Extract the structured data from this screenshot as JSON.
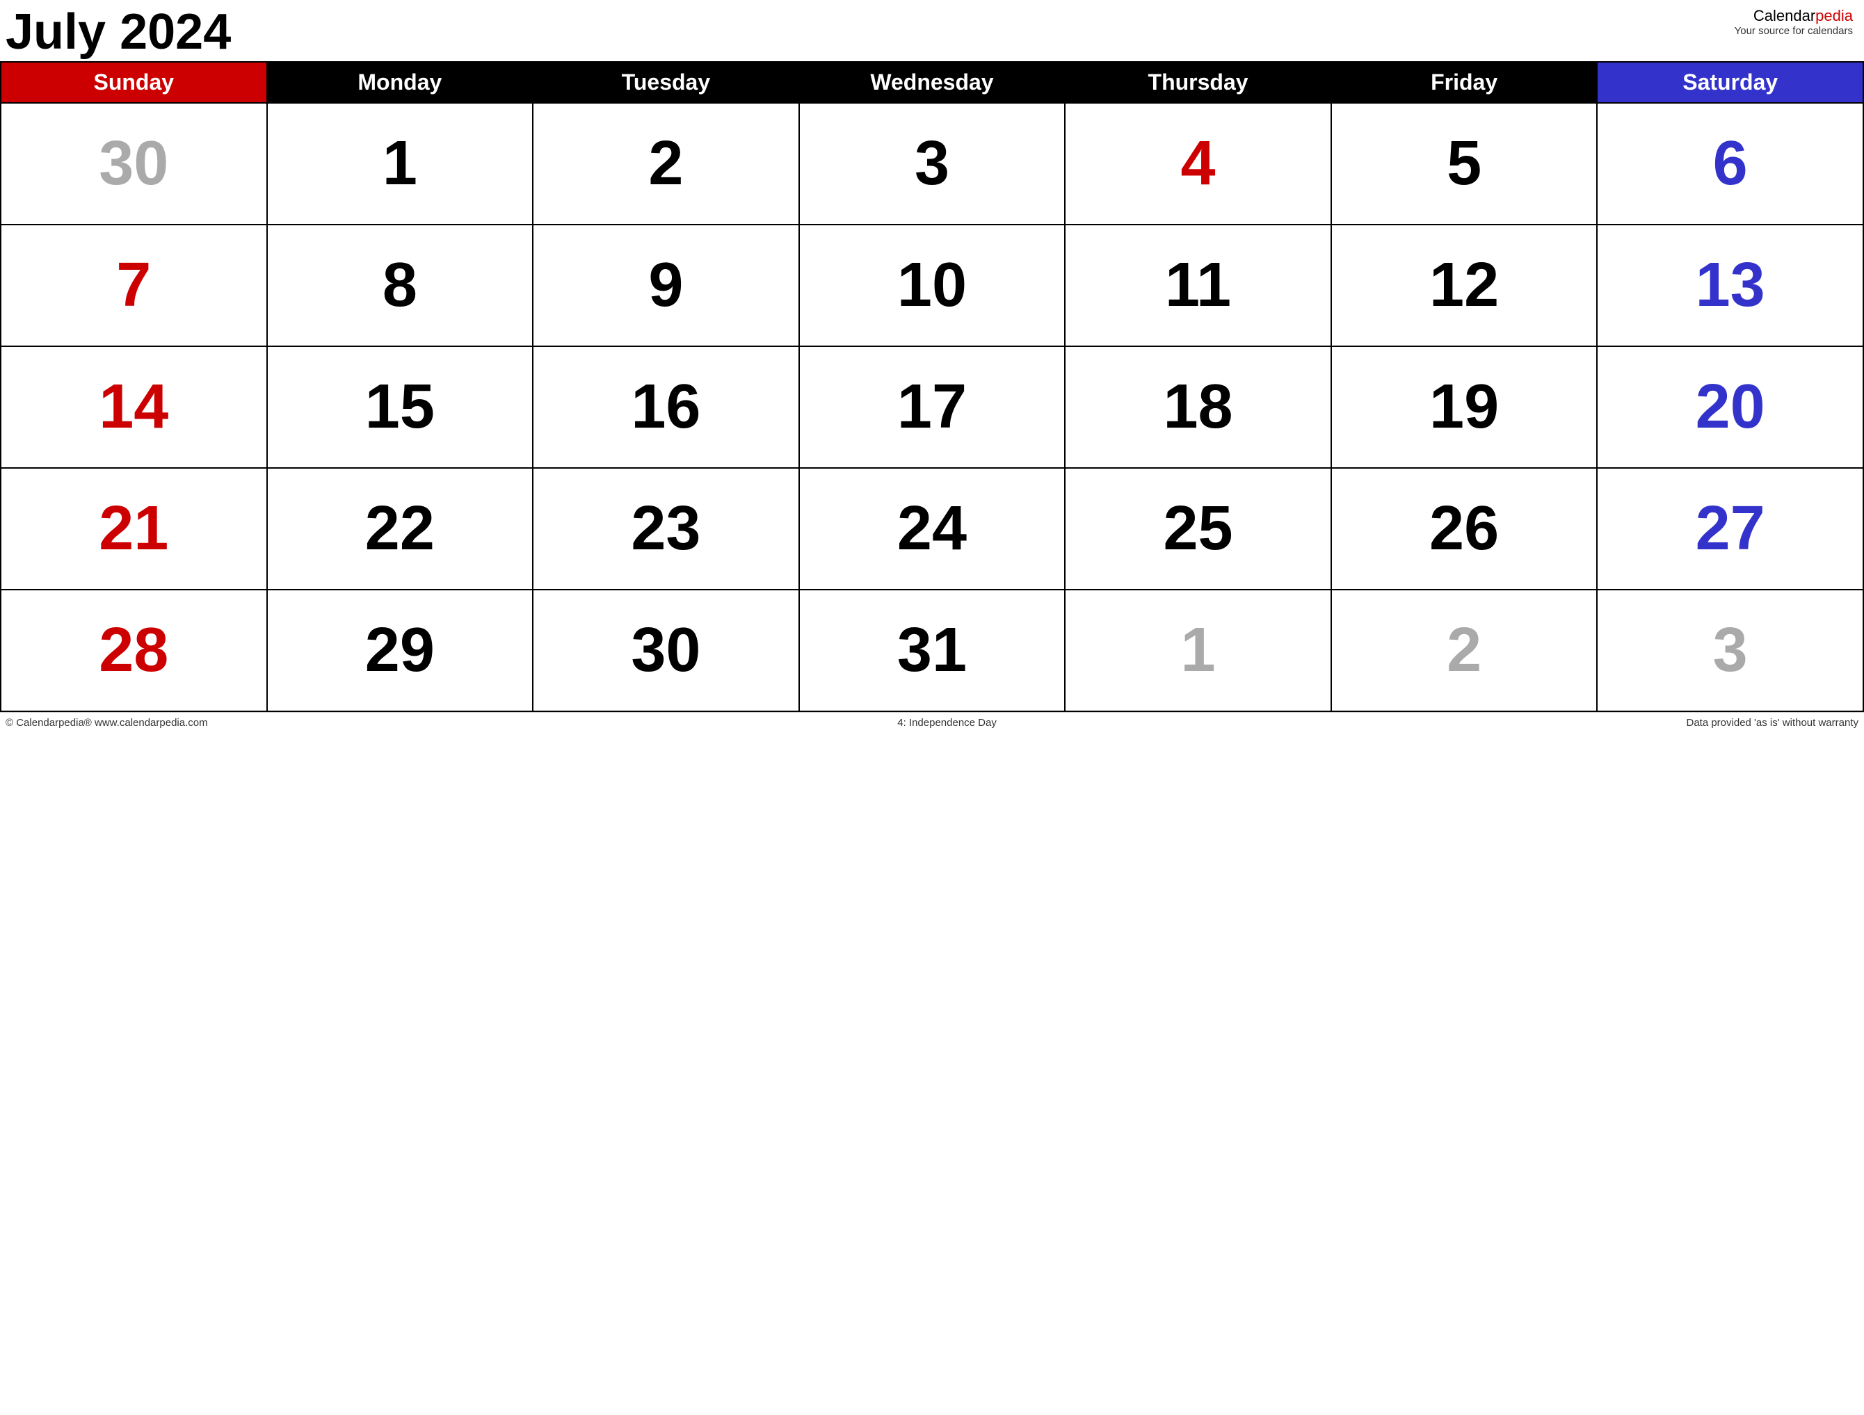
{
  "header": {
    "title": "July 2024",
    "brand_name": "Calendar",
    "brand_name_accent": "pedia",
    "brand_tagline": "Your source for calendars"
  },
  "weekdays": [
    {
      "label": "Sunday",
      "class": "th-sunday"
    },
    {
      "label": "Monday",
      "class": "th-monday"
    },
    {
      "label": "Tuesday",
      "class": "th-tuesday"
    },
    {
      "label": "Wednesday",
      "class": "th-wednesday"
    },
    {
      "label": "Thursday",
      "class": "th-thursday"
    },
    {
      "label": "Friday",
      "class": "th-friday"
    },
    {
      "label": "Saturday",
      "class": "th-saturday"
    }
  ],
  "weeks": [
    [
      {
        "day": "30",
        "color": "day-gray"
      },
      {
        "day": "1",
        "color": "day-black"
      },
      {
        "day": "2",
        "color": "day-black"
      },
      {
        "day": "3",
        "color": "day-black"
      },
      {
        "day": "4",
        "color": "day-red"
      },
      {
        "day": "5",
        "color": "day-black"
      },
      {
        "day": "6",
        "color": "day-blue"
      }
    ],
    [
      {
        "day": "7",
        "color": "day-red"
      },
      {
        "day": "8",
        "color": "day-black"
      },
      {
        "day": "9",
        "color": "day-black"
      },
      {
        "day": "10",
        "color": "day-black"
      },
      {
        "day": "11",
        "color": "day-black"
      },
      {
        "day": "12",
        "color": "day-black"
      },
      {
        "day": "13",
        "color": "day-blue"
      }
    ],
    [
      {
        "day": "14",
        "color": "day-red"
      },
      {
        "day": "15",
        "color": "day-black"
      },
      {
        "day": "16",
        "color": "day-black"
      },
      {
        "day": "17",
        "color": "day-black"
      },
      {
        "day": "18",
        "color": "day-black"
      },
      {
        "day": "19",
        "color": "day-black"
      },
      {
        "day": "20",
        "color": "day-blue"
      }
    ],
    [
      {
        "day": "21",
        "color": "day-red"
      },
      {
        "day": "22",
        "color": "day-black"
      },
      {
        "day": "23",
        "color": "day-black"
      },
      {
        "day": "24",
        "color": "day-black"
      },
      {
        "day": "25",
        "color": "day-black"
      },
      {
        "day": "26",
        "color": "day-black"
      },
      {
        "day": "27",
        "color": "day-blue"
      }
    ],
    [
      {
        "day": "28",
        "color": "day-red"
      },
      {
        "day": "29",
        "color": "day-black"
      },
      {
        "day": "30",
        "color": "day-black"
      },
      {
        "day": "31",
        "color": "day-black"
      },
      {
        "day": "1",
        "color": "day-gray"
      },
      {
        "day": "2",
        "color": "day-gray"
      },
      {
        "day": "3",
        "color": "day-gray"
      }
    ]
  ],
  "footer": {
    "left": "© Calendarpedia®   www.calendarpedia.com",
    "center": "4: Independence Day",
    "right": "Data provided 'as is' without warranty"
  }
}
